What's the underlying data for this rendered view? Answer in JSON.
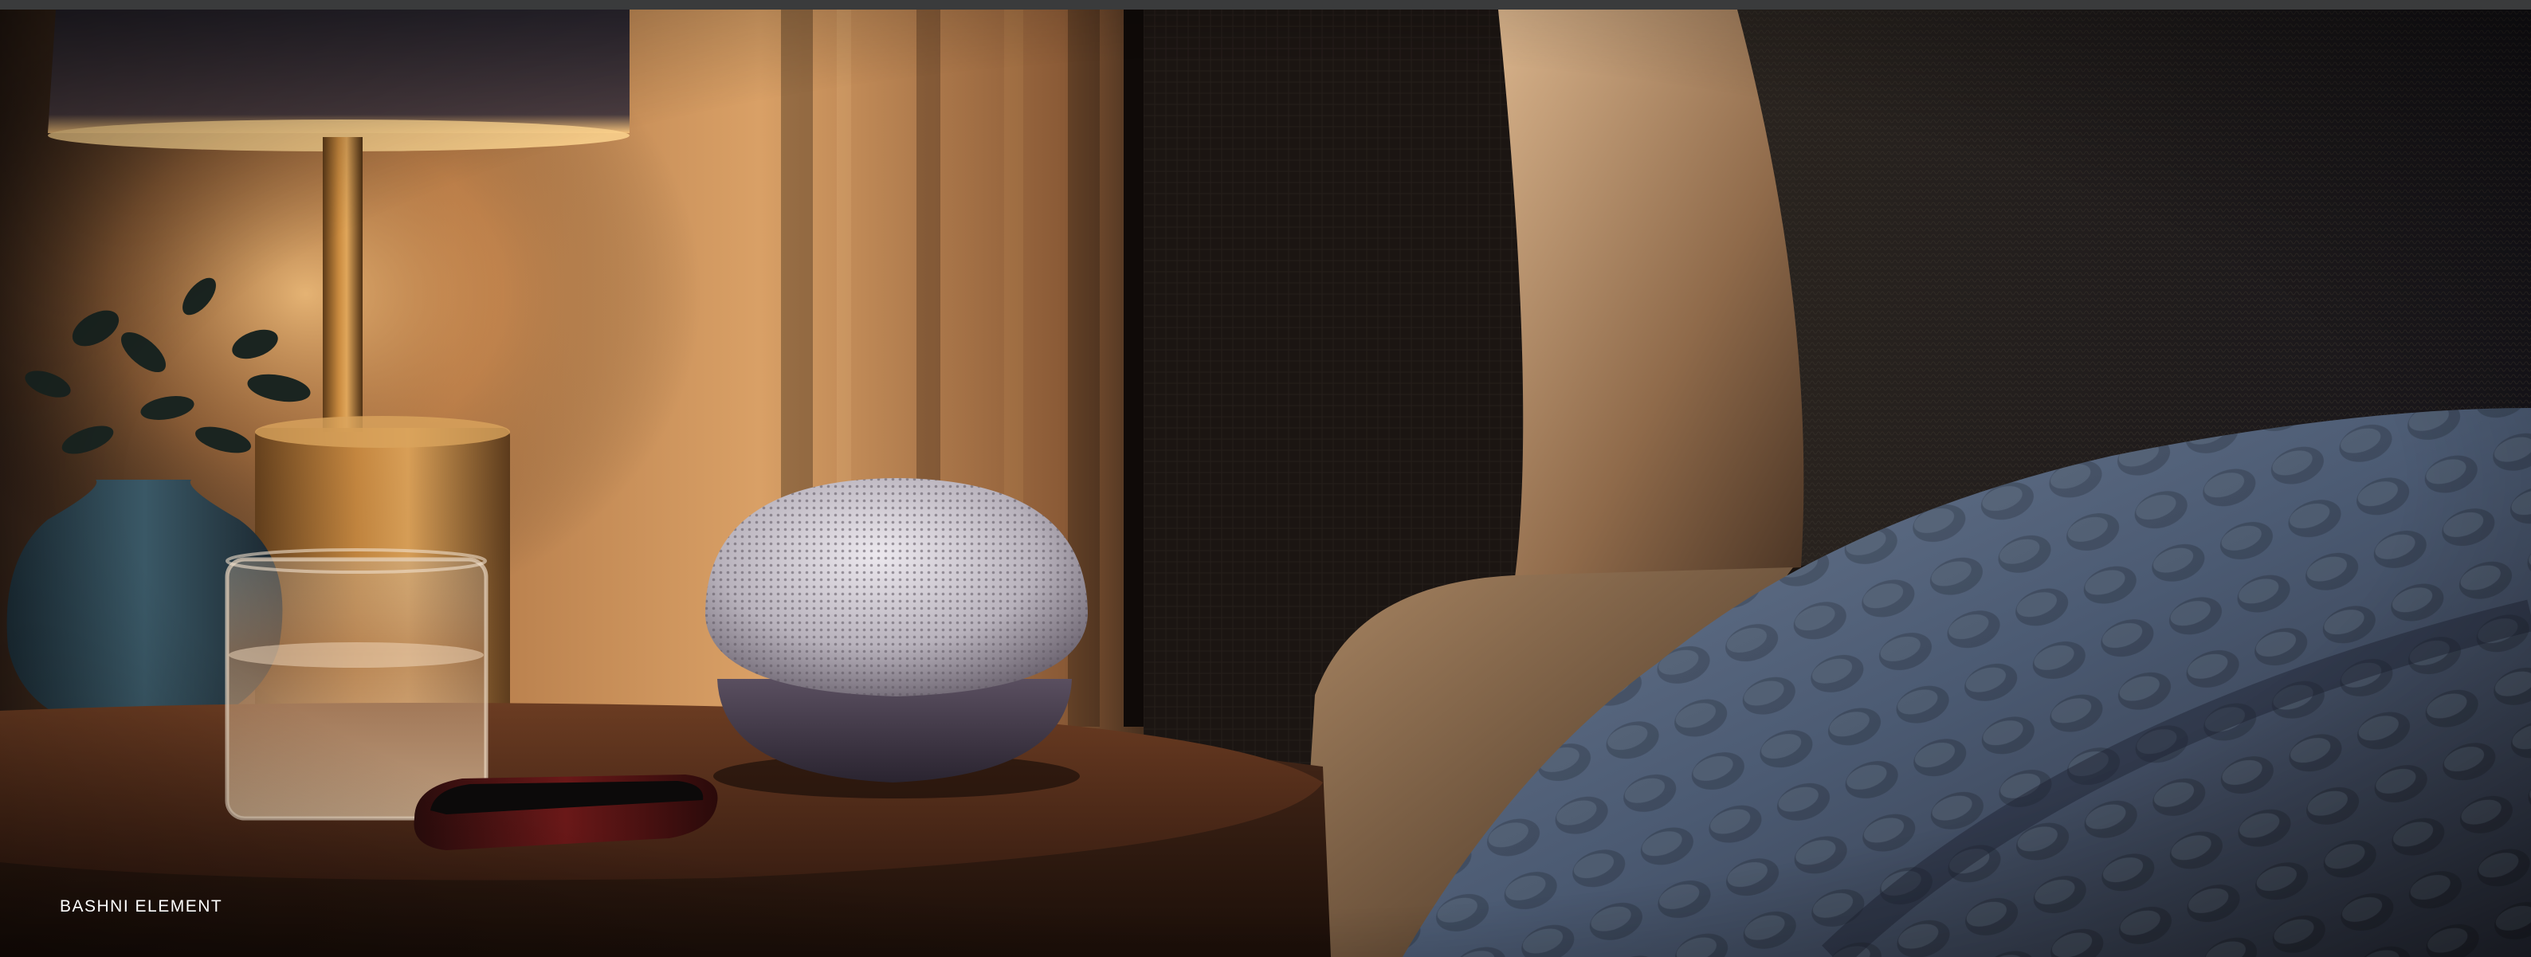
{
  "caption": {
    "text": "BASHNI ELEMENT"
  },
  "colors": {
    "top_bar": "#3a3b3c",
    "caption_text": "#ffffff",
    "lamp_glow": "#f2b46a",
    "speaker_mesh": "#c8c4cc",
    "speaker_base": "#3d3645",
    "blanket": "#56657d",
    "table_wood": "#4a2a1a"
  }
}
